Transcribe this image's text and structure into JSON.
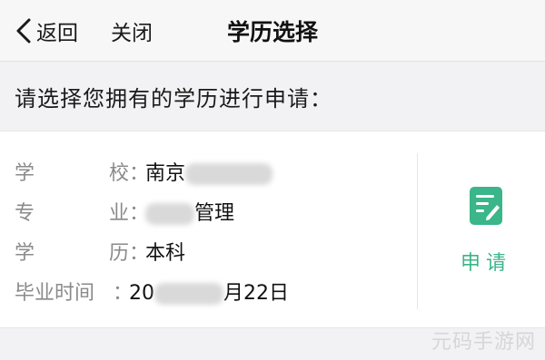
{
  "nav": {
    "back_label": "返回",
    "close_label": "关闭",
    "title": "学历选择"
  },
  "prompt": "请选择您拥有的学历进行申请：",
  "education": {
    "school_label": [
      "学",
      "校"
    ],
    "school_value": "南京",
    "major_label": [
      "专",
      "业"
    ],
    "major_value": "管理",
    "degree_label": [
      "学",
      "历"
    ],
    "degree_value": "本科",
    "graduation_label": "毕业时间",
    "graduation_value_prefix": "20",
    "graduation_value_suffix": "月22日"
  },
  "apply": {
    "label": "申请",
    "icon": "edit-document-icon",
    "color": "#3bb58a"
  },
  "watermark": "元码手游网"
}
